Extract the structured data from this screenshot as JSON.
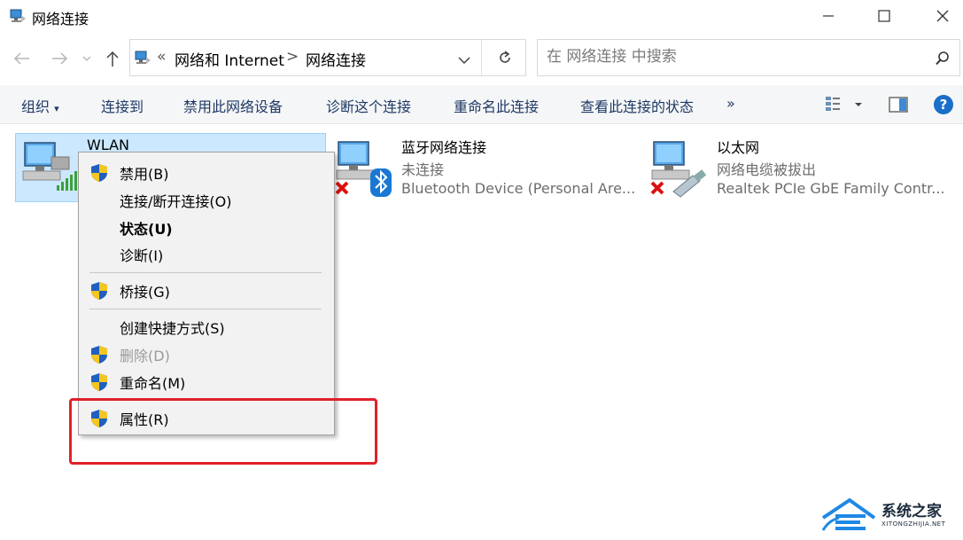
{
  "window": {
    "title": "网络连接",
    "minimize_icon": "minimize-icon",
    "maximize_icon": "maximize-icon",
    "close_icon": "close-icon"
  },
  "address": {
    "overflow": "«",
    "crumbs": [
      "网络和 Internet",
      "网络连接"
    ],
    "separator": ">",
    "search_placeholder": "在 网络连接 中搜索"
  },
  "toolbar": {
    "organize": "组织",
    "connect_to": "连接到",
    "disable_device": "禁用此网络设备",
    "diagnose": "诊断这个连接",
    "rename": "重命名此连接",
    "view_status": "查看此连接的状态",
    "more": "»"
  },
  "connections": [
    {
      "name": "WLAN",
      "status": "",
      "device": ""
    },
    {
      "name": "蓝牙网络连接",
      "status": "未连接",
      "device": "Bluetooth Device (Personal Are..."
    },
    {
      "name": "以太网",
      "status": "网络电缆被拔出",
      "device": "Realtek PCIe GbE Family Contr..."
    }
  ],
  "context_menu": {
    "items": [
      {
        "label": "禁用(B)",
        "shield": true
      },
      {
        "label": "连接/断开连接(O)",
        "shield": false
      },
      {
        "label": "状态(U)",
        "shield": false,
        "bold": true
      },
      {
        "label": "诊断(I)",
        "shield": false
      },
      {
        "label": "桥接(G)",
        "shield": true
      },
      {
        "label": "创建快捷方式(S)",
        "shield": false
      },
      {
        "label": "删除(D)",
        "shield": true,
        "disabled": true
      },
      {
        "label": "重命名(M)",
        "shield": true
      },
      {
        "label": "属性(R)",
        "shield": true
      }
    ]
  },
  "watermark": {
    "title": "系统之家",
    "subtitle": "XITONGZHIJIA.NET"
  },
  "colors": {
    "selection": "#cce8ff",
    "highlight_box": "#e0202a",
    "link_text": "#1e3966"
  }
}
